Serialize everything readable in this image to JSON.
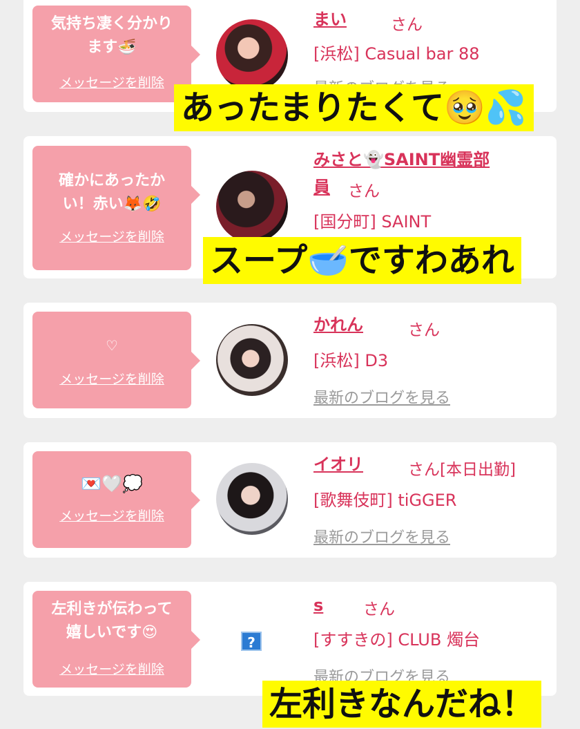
{
  "delete_label": "メッセージを削除",
  "honorific": "さん",
  "blog_label": "最新のブログを見る",
  "cards": [
    {
      "message": "気持ち凄く分かり\nます🍜",
      "name": "まい",
      "name_extra": "",
      "shop": "[浜松] Casual bar 88",
      "overlay": "あったまりたくて🥹💦"
    },
    {
      "message": "確かにあったか\nい！赤い🦊🤣",
      "name_line1": "みさと👻SAINT幽霊部",
      "name_line2": "員",
      "shop": "[国分町] SAINT",
      "overlay": "スープ🥣ですわあれ"
    },
    {
      "message": "♡",
      "name": "かれん",
      "name_extra": "",
      "shop": "[浜松] D3"
    },
    {
      "message": "💌🤍💭",
      "name": "イオリ",
      "name_extra": "[本日出勤]",
      "shop": "[歌舞伎町] tiGGER"
    },
    {
      "message": "左利きが伝わって\n嬉しいです😍",
      "name": "s",
      "name_extra": "",
      "shop": "[すすきの] CLUB 燭台",
      "avatar_placeholder": "?",
      "overlay": "左利きなんだね！"
    }
  ],
  "colors": {
    "accent": "#d8335a",
    "bubble": "#f5a0aa",
    "caption_bg": "#fffb00"
  }
}
